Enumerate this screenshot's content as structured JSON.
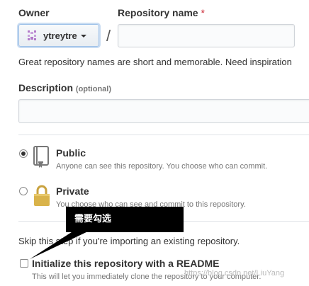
{
  "owner": {
    "label": "Owner",
    "username": "ytreytre",
    "avatar_icon": "identicon",
    "dropdown_icon": "caret-down"
  },
  "separator": "/",
  "repo_name": {
    "label": "Repository name",
    "required_mark": "*",
    "value": ""
  },
  "name_hint": "Great repository names are short and memorable. Need inspiration",
  "description": {
    "label": "Description",
    "optional": "(optional)",
    "value": ""
  },
  "visibility": {
    "public": {
      "title": "Public",
      "desc": "Anyone can see this repository. You choose who can commit.",
      "icon": "repo-book-icon",
      "selected": true
    },
    "private": {
      "title": "Private",
      "desc": "You choose who can see and commit to this repository.",
      "icon": "lock-icon",
      "selected": false
    }
  },
  "import_hint": "Skip this step if you're importing an existing repository.",
  "readme": {
    "label": "Initialize this repository with a README",
    "desc": "This will let you immediately clone the repository to your computer.",
    "checked": false
  },
  "annotation": {
    "text": "需要勾选"
  },
  "watermark": "https://blog.csdn.net/LiuYang",
  "colors": {
    "required": "#cb2431",
    "accent_border": "#9ec1e8",
    "callout_bg": "#000000",
    "lock_gold": "#d9b34a"
  }
}
